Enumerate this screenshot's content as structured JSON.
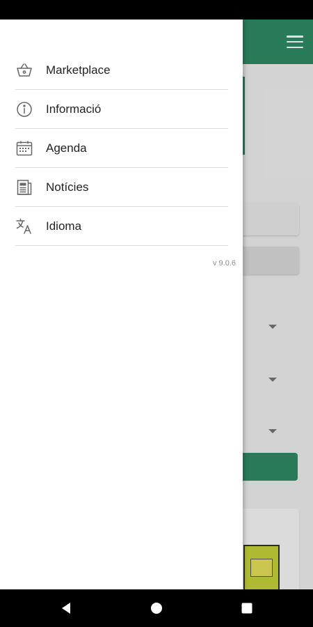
{
  "drawer": {
    "items": [
      {
        "label": "Marketplace",
        "icon": "basket-icon"
      },
      {
        "label": "Informació",
        "icon": "info-icon"
      },
      {
        "label": "Agenda",
        "icon": "calendar-icon"
      },
      {
        "label": "Notícies",
        "icon": "newspaper-icon"
      },
      {
        "label": "Idioma",
        "icon": "translate-icon"
      }
    ],
    "version": "v 9.0.6"
  },
  "colors": {
    "brand": "#2e8b65",
    "drawer_bg": "#ffffff",
    "divider": "#dddddd"
  },
  "icons": {
    "app_menu": "hamburger-menu-icon",
    "nav_back": "back-triangle-icon",
    "nav_home": "home-circle-icon",
    "nav_recents": "recents-square-icon"
  }
}
